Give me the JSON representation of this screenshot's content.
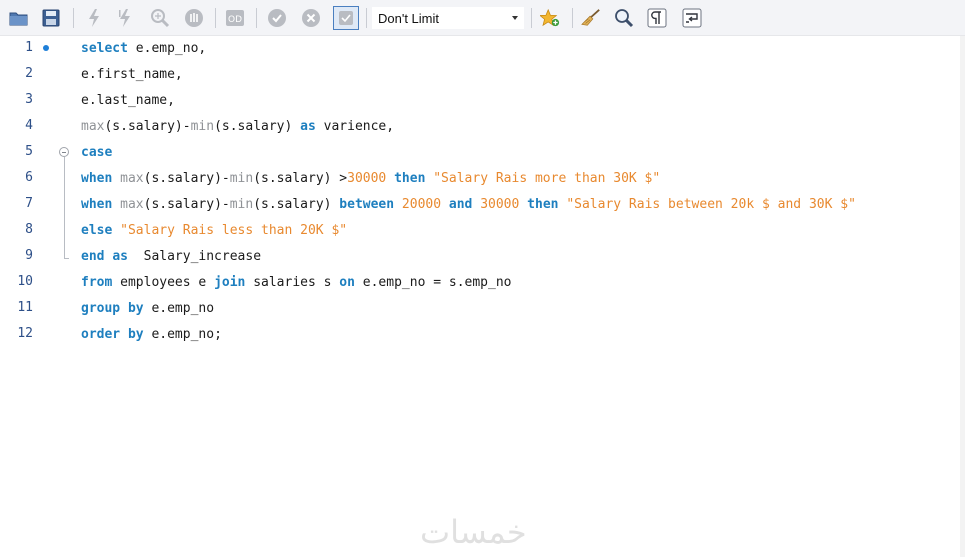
{
  "toolbar": {
    "buttons": [
      {
        "id": "open-folder",
        "icon": "folder-icon"
      },
      {
        "id": "save",
        "icon": "save-icon"
      },
      {
        "id": "execute",
        "icon": "lightning-icon"
      },
      {
        "id": "execute-current",
        "icon": "lightning-cursor-icon"
      },
      {
        "id": "explain",
        "icon": "magnifier-icon"
      },
      {
        "id": "stop",
        "icon": "stop-icon"
      },
      {
        "id": "toggle-continue",
        "icon": "continue-on-error-icon"
      },
      {
        "id": "commit",
        "icon": "check-icon"
      },
      {
        "id": "rollback",
        "icon": "cancel-icon"
      },
      {
        "id": "autocommit",
        "icon": "autocommit-icon"
      },
      {
        "id": "bookmark",
        "icon": "star-add-icon"
      },
      {
        "id": "beautify",
        "icon": "broom-icon"
      },
      {
        "id": "find",
        "icon": "search-icon"
      },
      {
        "id": "invisibles",
        "icon": "pilcrow-icon"
      },
      {
        "id": "wrap",
        "icon": "word-wrap-icon"
      }
    ],
    "limit_select": {
      "value": "Don't Limit"
    }
  },
  "editor": {
    "lines": [
      {
        "num": "1",
        "tokens": [
          [
            "kw",
            "select"
          ],
          [
            "id",
            " e.emp_no,"
          ]
        ]
      },
      {
        "num": "2",
        "tokens": [
          [
            "id",
            "e.first_name,"
          ]
        ]
      },
      {
        "num": "3",
        "tokens": [
          [
            "id",
            "e.last_name,"
          ]
        ]
      },
      {
        "num": "4",
        "tokens": [
          [
            "fn",
            "max"
          ],
          [
            "id",
            "(s.salary)-"
          ],
          [
            "fn",
            "min"
          ],
          [
            "id",
            "(s.salary) "
          ],
          [
            "kw",
            "as"
          ],
          [
            "id",
            " varience,"
          ]
        ]
      },
      {
        "num": "5",
        "tokens": [
          [
            "kw",
            "case"
          ]
        ]
      },
      {
        "num": "6",
        "tokens": [
          [
            "kw",
            "when"
          ],
          [
            "id",
            " "
          ],
          [
            "fn",
            "max"
          ],
          [
            "id",
            "(s.salary)-"
          ],
          [
            "fn",
            "min"
          ],
          [
            "id",
            "(s.salary) >"
          ],
          [
            "num",
            "30000"
          ],
          [
            "id",
            " "
          ],
          [
            "kw",
            "then"
          ],
          [
            "id",
            " "
          ],
          [
            "str",
            "\"Salary Rais more than 30K $\""
          ]
        ]
      },
      {
        "num": "7",
        "tokens": [
          [
            "kw",
            "when"
          ],
          [
            "id",
            " "
          ],
          [
            "fn",
            "max"
          ],
          [
            "id",
            "(s.salary)-"
          ],
          [
            "fn",
            "min"
          ],
          [
            "id",
            "(s.salary) "
          ],
          [
            "kw",
            "between"
          ],
          [
            "id",
            " "
          ],
          [
            "num",
            "20000"
          ],
          [
            "id",
            " "
          ],
          [
            "kw",
            "and"
          ],
          [
            "id",
            " "
          ],
          [
            "num",
            "30000"
          ],
          [
            "id",
            " "
          ],
          [
            "kw",
            "then"
          ],
          [
            "id",
            " "
          ],
          [
            "str",
            "\"Salary Rais between 20k $ and 30K $\""
          ]
        ]
      },
      {
        "num": "8",
        "tokens": [
          [
            "kw",
            "else"
          ],
          [
            "id",
            " "
          ],
          [
            "str",
            "\"Salary Rais less than 20K $\""
          ]
        ]
      },
      {
        "num": "9",
        "tokens": [
          [
            "kw",
            "end"
          ],
          [
            "id",
            " "
          ],
          [
            "kw",
            "as"
          ],
          [
            "id",
            "  Salary_increase"
          ]
        ]
      },
      {
        "num": "10",
        "tokens": [
          [
            "kw",
            "from"
          ],
          [
            "id",
            " employees e "
          ],
          [
            "kw",
            "join"
          ],
          [
            "id",
            " salaries s "
          ],
          [
            "kw",
            "on"
          ],
          [
            "id",
            " e.emp_no = s.emp_no"
          ]
        ]
      },
      {
        "num": "11",
        "tokens": [
          [
            "kw",
            "group by"
          ],
          [
            "id",
            " e.emp_no"
          ]
        ]
      },
      {
        "num": "12",
        "tokens": [
          [
            "kw",
            "order by"
          ],
          [
            "id",
            " e.emp_no;"
          ]
        ]
      }
    ]
  },
  "watermark": {
    "text": "خمسات"
  },
  "colors": {
    "keyword": "#1e7fbf",
    "function": "#8f9296",
    "number": "#e8892f",
    "string": "#e8892f",
    "line_number": "#2d4f88",
    "toolbar_bg": "#f3f4f7"
  }
}
